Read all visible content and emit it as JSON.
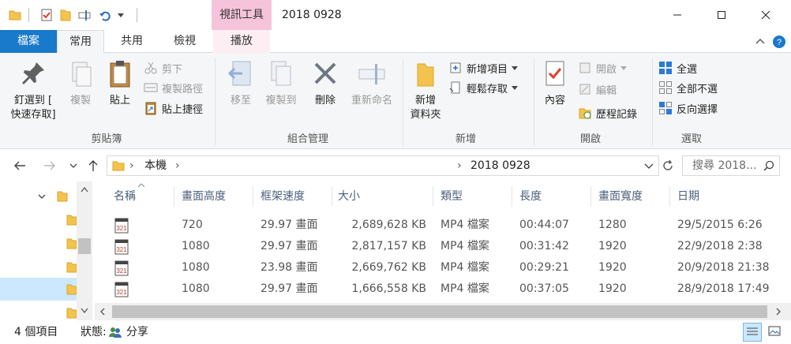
{
  "window": {
    "context_tab": "視訊工具",
    "title": "2018 0928"
  },
  "ribbon_tabs": [
    {
      "label": "檔案"
    },
    {
      "label": "常用"
    },
    {
      "label": "共用"
    },
    {
      "label": "檢視"
    },
    {
      "label": "播放"
    }
  ],
  "clipboard": {
    "pin_label": "釘選到 [",
    "pin_label2": "快速存取]",
    "copy_label": "複製",
    "paste_label": "貼上",
    "cut_label": "剪下",
    "copy_path_label": "複製路徑",
    "paste_shortcut_label": "貼上捷徑",
    "group_label": "剪貼簿"
  },
  "organize": {
    "move_to_label": "移至",
    "copy_to_label": "複製到",
    "delete_label": "刪除",
    "rename_label": "重新命名",
    "group_label": "組合管理"
  },
  "new_group": {
    "new_folder_label": "新增",
    "new_folder_label2": "資料夾",
    "new_item_label": "新增項目",
    "easy_access_label": "輕鬆存取",
    "group_label": "新增"
  },
  "open_group": {
    "properties_label": "內容",
    "open_label": "開啟",
    "edit_label": "編輯",
    "history_label": "歷程記錄",
    "group_label": "開啟"
  },
  "select_group": {
    "select_all_label": "全選",
    "select_none_label": "全部不選",
    "invert_label": "反向選擇",
    "group_label": "選取"
  },
  "address": {
    "crumb_pc": "本機",
    "crumb_folder": "2018 0928",
    "search_placeholder": "搜尋 2018..."
  },
  "columns": [
    "名稱",
    "畫面高度",
    "框架速度",
    "大小",
    "類型",
    "長度",
    "畫面寬度",
    "日期"
  ],
  "files": [
    {
      "height": "720",
      "fps": "29.97 畫面",
      "size": "2,689,628 KB",
      "type": "MP4 檔案",
      "length": "00:44:07",
      "width": "1280",
      "date": "29/5/2015 6:26"
    },
    {
      "height": "1080",
      "fps": "29.97 畫面",
      "size": "2,817,157 KB",
      "type": "MP4 檔案",
      "length": "00:31:42",
      "width": "1920",
      "date": "22/9/2018 2:38"
    },
    {
      "height": "1080",
      "fps": "23.98 畫面",
      "size": "2,669,762 KB",
      "type": "MP4 檔案",
      "length": "00:29:21",
      "width": "1920",
      "date": "20/9/2018 21:38"
    },
    {
      "height": "1080",
      "fps": "29.97 畫面",
      "size": "1,666,558 KB",
      "type": "MP4 檔案",
      "length": "00:37:05",
      "width": "1920",
      "date": "28/9/2018 17:49"
    }
  ],
  "status": {
    "item_count": "4 個項目",
    "state_label": "狀態:",
    "shared_label": "分享"
  },
  "colors": {
    "file_tab": "#1979ca",
    "context_tab": "#f6c4da",
    "nav_selected": "#cce8ff",
    "ribbon_bg": "#f5f6f7"
  },
  "icons": [
    "folder-icon",
    "properties-check-icon",
    "rename-icon",
    "undo-icon",
    "minimize-icon",
    "maximize-icon",
    "close-icon",
    "pin-icon",
    "copy-icon",
    "paste-icon",
    "cut-icon",
    "move-to-icon",
    "delete-icon",
    "new-folder-icon",
    "properties-icon",
    "select-all-icon",
    "back-arrow-icon",
    "forward-arrow-icon",
    "up-arrow-icon",
    "refresh-icon",
    "search-icon",
    "video-file-icon",
    "details-view-icon",
    "large-icons-view-icon",
    "share-users-icon"
  ]
}
